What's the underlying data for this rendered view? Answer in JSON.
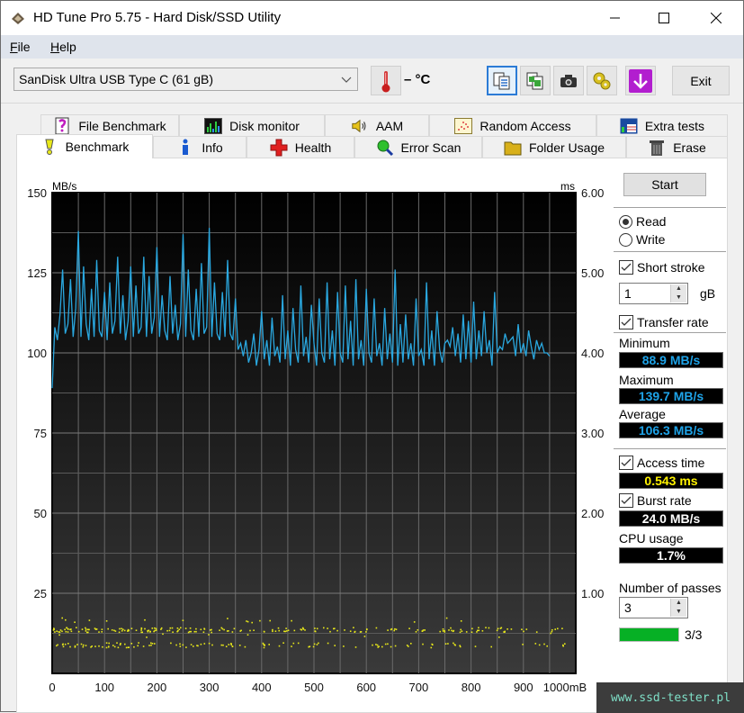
{
  "window": {
    "title": "HD Tune Pro 5.75 - Hard Disk/SSD Utility",
    "controls": {
      "minimize": "minimize-icon",
      "maximize": "maximize-icon",
      "close": "close-icon"
    }
  },
  "menu": {
    "items": [
      {
        "label": "File",
        "accel": "F",
        "rest": "ile"
      },
      {
        "label": "Help",
        "accel": "H",
        "rest": "elp"
      }
    ]
  },
  "toolbar": {
    "drive": "SanDisk Ultra USB Type C (61 gB)",
    "temperature": "– °C",
    "icons": [
      "thermometer-icon",
      "copy-text-icon",
      "copy-image-icon",
      "screenshot-icon",
      "options-icon",
      "save-icon"
    ],
    "exit_label": "Exit"
  },
  "tabs": {
    "row_back": [
      {
        "label": "File Benchmark",
        "icon": "file-benchmark-icon"
      },
      {
        "label": "Disk monitor",
        "icon": "disk-monitor-icon"
      },
      {
        "label": "AAM",
        "icon": "speaker-icon"
      },
      {
        "label": "Random Access",
        "icon": "random-access-icon"
      },
      {
        "label": "Extra tests",
        "icon": "extra-tests-icon"
      }
    ],
    "row_front": [
      {
        "label": "Benchmark",
        "icon": "benchmark-icon",
        "selected": true
      },
      {
        "label": "Info",
        "icon": "info-icon"
      },
      {
        "label": "Health",
        "icon": "health-icon"
      },
      {
        "label": "Error Scan",
        "icon": "magnifier-icon"
      },
      {
        "label": "Folder Usage",
        "icon": "folder-icon"
      },
      {
        "label": "Erase",
        "icon": "trash-icon"
      }
    ]
  },
  "side": {
    "start_label": "Start",
    "mode": {
      "read": "Read",
      "write": "Write",
      "selected": "read"
    },
    "short_stroke": {
      "label": "Short stroke",
      "checked": true,
      "value": "1",
      "unit": "gB"
    },
    "transfer_rate": {
      "label": "Transfer rate",
      "checked": true
    },
    "minimum": {
      "label": "Minimum",
      "value": "88.9 MB/s"
    },
    "maximum": {
      "label": "Maximum",
      "value": "139.7 MB/s"
    },
    "average": {
      "label": "Average",
      "value": "106.3 MB/s"
    },
    "access_time": {
      "label": "Access time",
      "checked": true,
      "value": "0.543 ms"
    },
    "burst_rate": {
      "label": "Burst rate",
      "checked": true,
      "value": "24.0 MB/s"
    },
    "cpu_usage": {
      "label": "CPU usage",
      "value": "1.7%"
    },
    "passes": {
      "label": "Number of passes",
      "value": "3",
      "progress": 1.0,
      "progress_text": "3/3"
    }
  },
  "watermark": "www.ssd-tester.pl",
  "colors": {
    "read_line": "#2aa8e0",
    "access_points": "#e8e81a",
    "progress": "#06b025",
    "value_blue": "#1ea3e8",
    "value_yellow": "#fff200"
  },
  "chart_data": {
    "type": "line",
    "title": "",
    "xlabel": "mB",
    "ylabel": "MB/s",
    "y2label": "ms",
    "xlim": [
      0,
      1000
    ],
    "ylim": [
      0,
      150
    ],
    "y2lim": [
      0,
      6
    ],
    "x_ticks": [
      "0",
      "100",
      "200",
      "300",
      "400",
      "500",
      "600",
      "700",
      "800",
      "900",
      "1000mB"
    ],
    "y_ticks": [
      "25",
      "50",
      "75",
      "100",
      "125",
      "150"
    ],
    "y2_ticks": [
      "1.00",
      "2.00",
      "3.00",
      "4.00",
      "5.00",
      "6.00"
    ],
    "grid": true,
    "series": [
      {
        "name": "Transfer rate (read)",
        "axis": "left",
        "x": [
          0,
          5,
          10,
          15,
          20,
          25,
          30,
          35,
          40,
          45,
          50,
          55,
          60,
          65,
          70,
          75,
          80,
          85,
          90,
          95,
          100,
          105,
          110,
          115,
          120,
          125,
          130,
          135,
          140,
          145,
          150,
          155,
          160,
          165,
          170,
          175,
          180,
          185,
          190,
          195,
          200,
          205,
          210,
          215,
          220,
          225,
          230,
          235,
          240,
          245,
          250,
          255,
          260,
          265,
          270,
          275,
          280,
          285,
          290,
          295,
          300,
          305,
          310,
          315,
          320,
          325,
          330,
          335,
          340,
          345,
          350,
          355,
          360,
          365,
          370,
          375,
          380,
          385,
          390,
          395,
          400,
          405,
          410,
          415,
          420,
          425,
          430,
          435,
          440,
          445,
          450,
          455,
          460,
          465,
          470,
          475,
          480,
          485,
          490,
          495,
          500,
          505,
          510,
          515,
          520,
          525,
          530,
          535,
          540,
          545,
          550,
          555,
          560,
          565,
          570,
          575,
          580,
          585,
          590,
          595,
          600,
          605,
          610,
          615,
          620,
          625,
          630,
          635,
          640,
          645,
          650,
          655,
          660,
          665,
          670,
          675,
          680,
          685,
          690,
          695,
          700,
          705,
          710,
          715,
          720,
          725,
          730,
          735,
          740,
          745,
          750,
          755,
          760,
          765,
          770,
          775,
          780,
          785,
          790,
          795,
          800,
          805,
          810,
          815,
          820,
          825,
          830,
          835,
          840,
          845,
          850,
          855,
          860,
          865,
          870,
          875,
          880,
          885,
          890,
          895,
          900,
          905,
          910,
          915,
          920,
          925,
          930,
          935,
          940,
          945,
          950,
          955,
          960,
          965,
          970,
          975,
          980,
          985,
          990,
          995,
          1000
        ],
        "values": [
          89,
          108,
          104,
          112,
          126,
          106,
          109,
          123,
          105,
          114,
          138,
          105,
          127,
          109,
          104,
          120,
          105,
          129,
          107,
          105,
          119,
          104,
          122,
          106,
          110,
          130,
          106,
          118,
          104,
          110,
          127,
          105,
          121,
          106,
          108,
          130,
          105,
          124,
          106,
          111,
          133,
          105,
          118,
          107,
          104,
          124,
          106,
          115,
          104,
          109,
          137,
          105,
          126,
          107,
          104,
          120,
          105,
          128,
          106,
          108,
          139,
          105,
          122,
          106,
          104,
          119,
          105,
          129,
          106,
          104,
          117,
          101,
          103,
          99,
          104,
          97,
          100,
          106,
          96,
          101,
          113,
          98,
          104,
          96,
          111,
          99,
          102,
          97,
          118,
          98,
          107,
          96,
          114,
          101,
          97,
          121,
          99,
          105,
          97,
          115,
          103,
          96,
          117,
          100,
          97,
          122,
          98,
          107,
          96,
          119,
          100,
          97,
          121,
          98,
          110,
          96,
          123,
          98,
          104,
          96,
          120,
          100,
          97,
          117,
          99,
          103,
          96,
          114,
          98,
          106,
          97,
          126,
          96,
          109,
          97,
          112,
          98,
          103,
          96,
          117,
          99,
          101,
          96,
          122,
          98,
          107,
          96,
          113,
          101,
          97,
          103,
          104,
          102,
          108,
          99,
          106,
          97,
          112,
          98,
          110,
          97,
          116,
          98,
          107,
          99,
          113,
          100,
          104,
          96,
          119,
          100,
          102,
          101,
          106,
          103,
          104,
          105,
          99,
          109,
          100,
          103,
          99,
          107,
          102,
          98,
          104,
          101,
          103,
          100,
          100,
          99
        ]
      },
      {
        "name": "Access time",
        "axis": "right",
        "style": "scatter",
        "bands_ms": [
          0.55,
          0.36
        ],
        "note": "yellow scatter points roughly 0.3–0.7 ms across 0–980 mB"
      }
    ]
  }
}
